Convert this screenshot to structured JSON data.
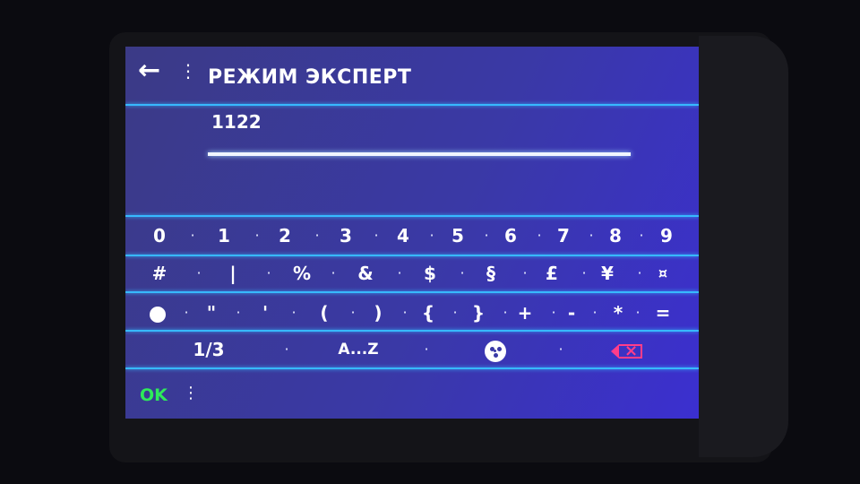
{
  "header": {
    "back_icon": "←",
    "menu_icon": "⋮",
    "title": "РЕЖИМ ЭКСПЕРТ"
  },
  "input": {
    "value": "1122"
  },
  "keyboard": {
    "row1": [
      "0",
      "1",
      "2",
      "3",
      "4",
      "5",
      "6",
      "7",
      "8",
      "9"
    ],
    "row2": [
      "#",
      "|",
      "%",
      "&",
      "$",
      "§",
      "£",
      "¥",
      "¤"
    ],
    "row3": [
      "",
      "\"",
      "'",
      "(",
      ")",
      "{",
      "}",
      "+",
      "-",
      "*",
      "="
    ],
    "row4": {
      "page_label": "1/3",
      "letters_label": "A...Z",
      "emoji_icon": "emoji-icon",
      "backspace_icon": "backspace-icon"
    },
    "separator": "·"
  },
  "footer": {
    "ok_label": "OK",
    "menu_icon": "⋮"
  },
  "colors": {
    "accent_line": "#37b9ff",
    "ok_green": "#2eea5a",
    "backspace_pink": "#ff3d8a"
  }
}
